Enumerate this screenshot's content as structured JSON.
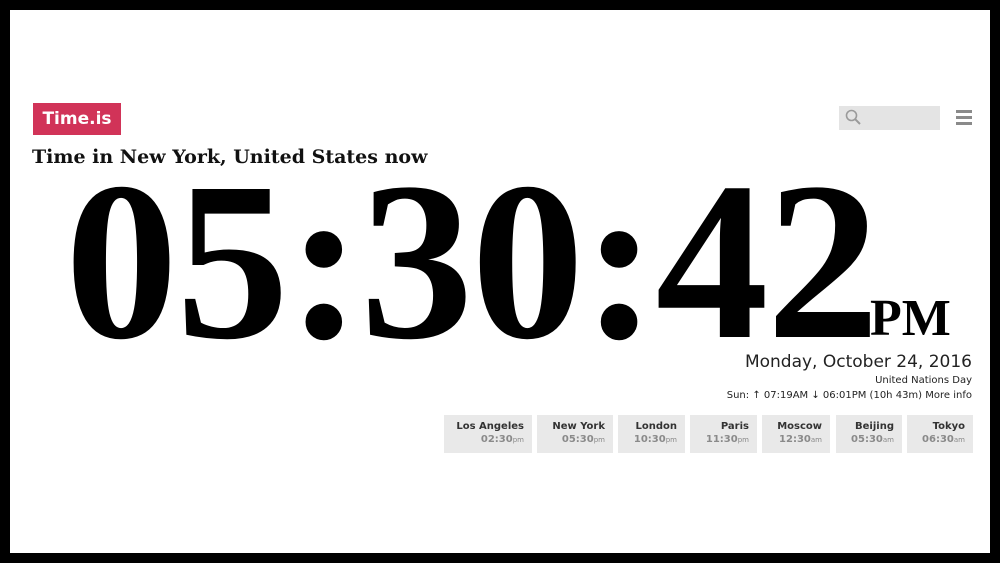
{
  "header": {
    "logo_text": "Time.is",
    "search_placeholder": "",
    "search_icon": "search-icon",
    "menu_icon": "hamburger-menu-icon"
  },
  "main": {
    "title": "Time in New York, United States now",
    "clock": {
      "time": "05:30:42",
      "ampm": "PM"
    },
    "date": "Monday, October 24, 2016",
    "holiday": "United Nations Day",
    "sun": {
      "text": "Sun: ↑ 07:19AM ↓ 06:01PM (10h 43m)",
      "more_info": "More info"
    }
  },
  "cities": [
    {
      "name": "Los Angeles",
      "time": "02:30",
      "ampm": "pm"
    },
    {
      "name": "New York",
      "time": "05:30",
      "ampm": "pm"
    },
    {
      "name": "London",
      "time": "10:30",
      "ampm": "pm"
    },
    {
      "name": "Paris",
      "time": "11:30",
      "ampm": "pm"
    },
    {
      "name": "Moscow",
      "time": "12:30",
      "ampm": "am"
    },
    {
      "name": "Beijing",
      "time": "05:30",
      "ampm": "am"
    },
    {
      "name": "Tokyo",
      "time": "06:30",
      "ampm": "am"
    }
  ],
  "colors": {
    "brand": "#d13358",
    "frame": "#000000",
    "tile_background": "#e9e9e9",
    "search_background": "#e4e4e4"
  }
}
